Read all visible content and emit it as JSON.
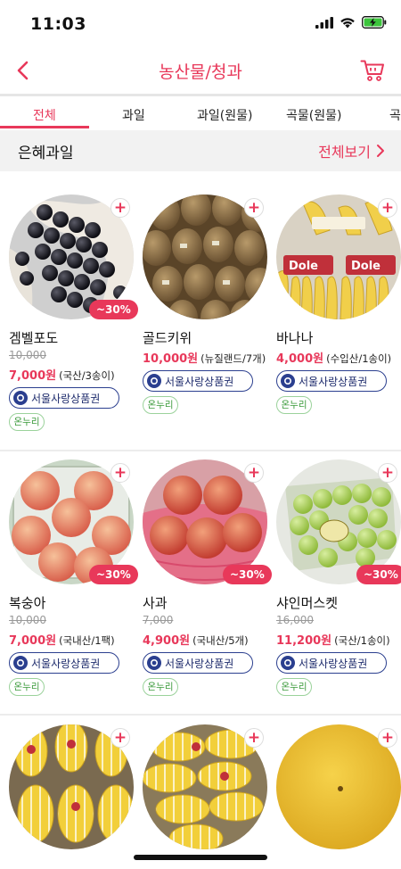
{
  "status_bar": {
    "time": "11:03"
  },
  "header": {
    "title": "농산물/청과"
  },
  "tabs": [
    {
      "label": "전체",
      "active": true
    },
    {
      "label": "과일",
      "active": false
    },
    {
      "label": "과일(원물)",
      "active": false
    },
    {
      "label": "곡물(원물)",
      "active": false
    },
    {
      "label": "곡",
      "active": false
    }
  ],
  "section": {
    "title": "은혜과일",
    "view_all": "전체보기"
  },
  "colors": {
    "accent": "#e8385a",
    "voucher": "#2b3f8f",
    "onnuri": "#3a9a3a"
  },
  "products": [
    {
      "name": "겜벨포도",
      "original_price": "10,000",
      "price": "7,000원",
      "unit": "(국산/3송이)",
      "discount": "~30%",
      "voucher": "서울사랑상품권",
      "onnuri": "온누리",
      "image": "grapes"
    },
    {
      "name": "골드키위",
      "original_price": "",
      "price": "10,000원",
      "unit": "(뉴질랜드/7개)",
      "discount": "",
      "voucher": "서울사랑상품권",
      "onnuri": "온누리",
      "image": "kiwi"
    },
    {
      "name": "바나나",
      "original_price": "",
      "price": "4,000원",
      "unit": "(수입산/1송이)",
      "discount": "",
      "voucher": "서울사랑상품권",
      "onnuri": "온누리",
      "image": "banana"
    },
    {
      "name": "복숭아",
      "original_price": "10,000",
      "price": "7,000원",
      "unit": "(국내산/1팩)",
      "discount": "~30%",
      "voucher": "서울사랑상품권",
      "onnuri": "온누리",
      "image": "peach"
    },
    {
      "name": "사과",
      "original_price": "7,000",
      "price": "4,900원",
      "unit": "(국내산/5개)",
      "discount": "~30%",
      "voucher": "서울사랑상품권",
      "onnuri": "온누리",
      "image": "apple"
    },
    {
      "name": "샤인머스켓",
      "original_price": "16,000",
      "price": "11,200원",
      "unit": "(국산/1송이)",
      "discount": "~30%",
      "voucher": "서울사랑상품권",
      "onnuri": "온누리",
      "image": "shine-muscat"
    },
    {
      "name": "",
      "image": "melon"
    },
    {
      "name": "",
      "image": "melon"
    },
    {
      "name": "",
      "image": "pear"
    }
  ]
}
